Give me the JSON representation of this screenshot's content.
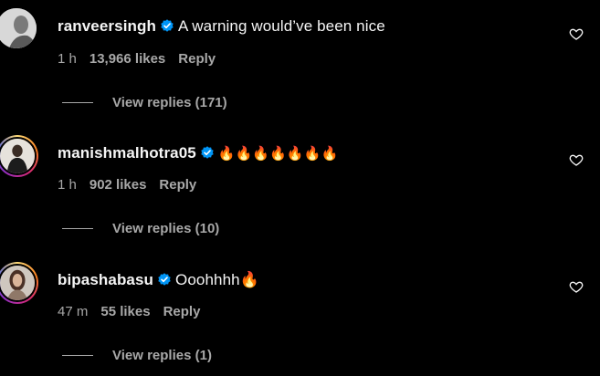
{
  "comments": [
    {
      "username": "ranveersingh",
      "text": "A warning would’ve been nice",
      "time": "1 h",
      "likes": "13,966 likes",
      "reply": "Reply",
      "view_replies": "View replies (171)",
      "avatar_style": "plain"
    },
    {
      "username": "manishmalhotra05",
      "text": "🔥🔥🔥🔥🔥🔥🔥",
      "time": "1 h",
      "likes": "902 likes",
      "reply": "Reply",
      "view_replies": "View replies (10)",
      "avatar_style": "story-ring"
    },
    {
      "username": "bipashabasu",
      "text": "Ooohhhh🔥",
      "time": "47 m",
      "likes": "55 likes",
      "reply": "Reply",
      "view_replies": "View replies (1)",
      "avatar_style": "story-ring"
    }
  ],
  "icons": {
    "verified": "verified-badge-icon",
    "like": "heart-outline-icon"
  },
  "colors": {
    "background": "#000000",
    "primary_text": "#f5f5f5",
    "secondary_text": "#a8a8a8",
    "verified_blue": "#0095f6"
  }
}
